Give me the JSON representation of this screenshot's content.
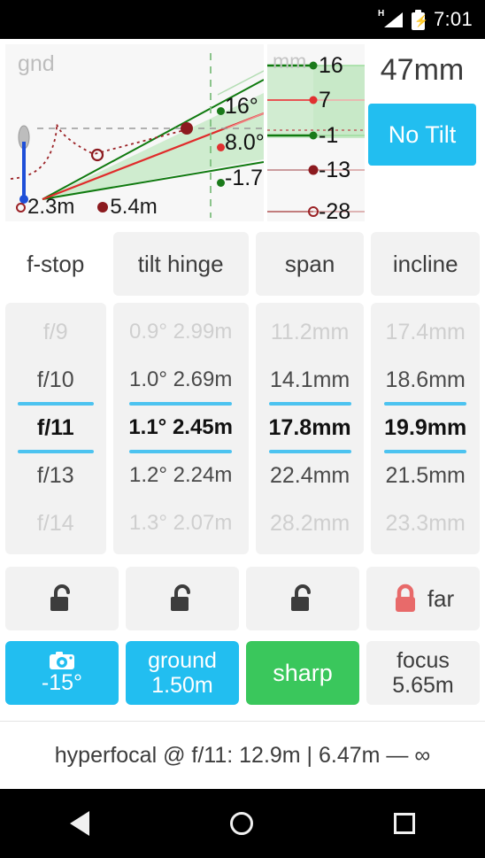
{
  "statusbar": {
    "network": "H",
    "time": "7:01",
    "signal_icon": "signal-bars-icon",
    "battery_icon": "battery-charging-icon"
  },
  "diagram": {
    "ground_label": "gnd",
    "mm_label": "mm",
    "legend": [
      {
        "marker": "open-circle",
        "label": "2.3m"
      },
      {
        "marker": "filled-circle",
        "label": "5.4m"
      }
    ],
    "angle_labels": [
      {
        "value": "16°",
        "color": "#1a7a1a"
      },
      {
        "value": "8.0°",
        "color": "#e03030"
      },
      {
        "value": "-1.7°",
        "color": "#1a7a1a"
      }
    ],
    "mm_scale": [
      {
        "value": "16",
        "color": "#1a7a1a"
      },
      {
        "value": "7",
        "color": "#e03030"
      },
      {
        "value": "-1",
        "color": "#1a7a1a"
      },
      {
        "value": "-13",
        "color": "#8c1a1f"
      },
      {
        "value": "-28",
        "color": "#9b2226"
      }
    ]
  },
  "header": {
    "focal_length": "47mm",
    "tilt_button": "No Tilt"
  },
  "columns": [
    {
      "id": "f-stop",
      "header": "f-stop",
      "header_plain": true,
      "cells": [
        {
          "text": "f/9",
          "state": "dim"
        },
        {
          "text": "f/10",
          "state": "normal"
        },
        {
          "text": "f/11",
          "state": "selected"
        },
        {
          "text": "f/13",
          "state": "normal"
        },
        {
          "text": "f/14",
          "state": "dim"
        }
      ]
    },
    {
      "id": "tilt-hinge",
      "header": "tilt  hinge",
      "header_plain": false,
      "cells": [
        {
          "text": "0.9° 2.99m",
          "state": "dim"
        },
        {
          "text": "1.0° 2.69m",
          "state": "normal"
        },
        {
          "text": "1.1° 2.45m",
          "state": "selected"
        },
        {
          "text": "1.2° 2.24m",
          "state": "normal"
        },
        {
          "text": "1.3° 2.07m",
          "state": "dim"
        }
      ]
    },
    {
      "id": "span",
      "header": "span",
      "header_plain": false,
      "cells": [
        {
          "text": "11.2mm",
          "state": "dim"
        },
        {
          "text": "14.1mm",
          "state": "normal"
        },
        {
          "text": "17.8mm",
          "state": "selected"
        },
        {
          "text": "22.4mm",
          "state": "normal"
        },
        {
          "text": "28.2mm",
          "state": "dim"
        }
      ]
    },
    {
      "id": "incline",
      "header": "incline",
      "header_plain": false,
      "cells": [
        {
          "text": "17.4mm",
          "state": "dim"
        },
        {
          "text": "18.6mm",
          "state": "normal"
        },
        {
          "text": "19.9mm",
          "state": "selected"
        },
        {
          "text": "21.5mm",
          "state": "normal"
        },
        {
          "text": "23.3mm",
          "state": "dim"
        }
      ]
    }
  ],
  "locks": [
    {
      "icon": "unlock-icon",
      "locked": false,
      "label": "",
      "color": "#3c3c3c"
    },
    {
      "icon": "unlock-icon",
      "locked": false,
      "label": "",
      "color": "#3c3c3c"
    },
    {
      "icon": "unlock-icon",
      "locked": false,
      "label": "",
      "color": "#3c3c3c"
    },
    {
      "icon": "lock-icon",
      "locked": true,
      "label": "far",
      "color": "#e86a6a"
    }
  ],
  "actions": [
    {
      "id": "camera-angle",
      "icon": "camera-icon",
      "line1": "",
      "line2": "-15°",
      "style": "cyan"
    },
    {
      "id": "ground",
      "icon": "",
      "line1": "ground",
      "line2": "1.50m",
      "style": "cyan"
    },
    {
      "id": "sharp",
      "icon": "",
      "line1": "sharp",
      "line2": "",
      "style": "green"
    },
    {
      "id": "focus",
      "icon": "",
      "line1": "focus",
      "line2": "5.65m",
      "style": "gray"
    }
  ],
  "footer": {
    "status": "hyperfocal @ f/11: 12.9m | 6.47m — ∞"
  },
  "navbar": {
    "back": "back-icon",
    "home": "home-icon",
    "recents": "recents-icon"
  },
  "colors": {
    "accent": "#22bef0",
    "green": "#3ac75c",
    "lock_red": "#e86a6a",
    "selected_underline": "#4cc3f0"
  }
}
